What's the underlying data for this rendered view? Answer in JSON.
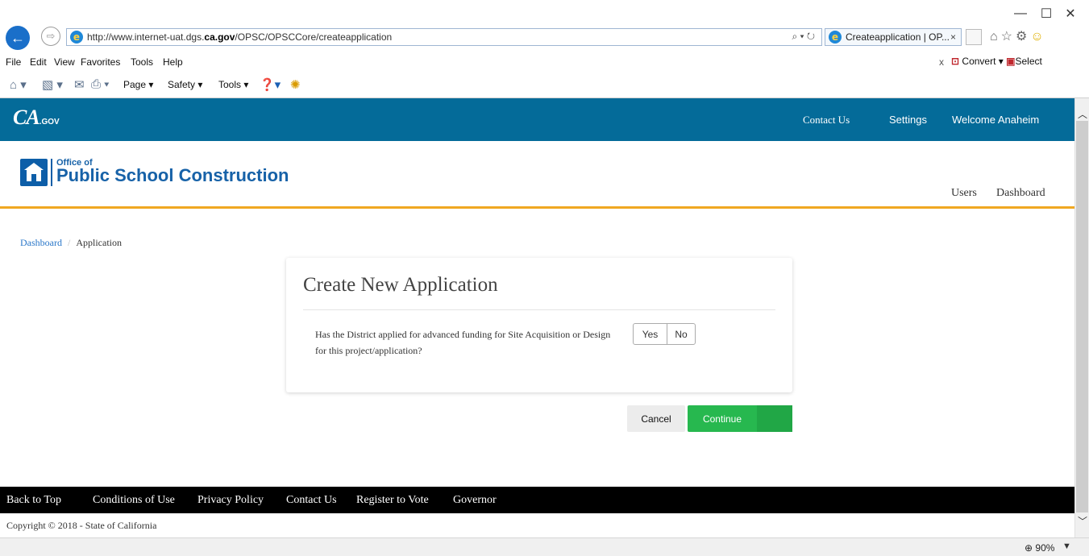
{
  "browser": {
    "url_prefix": "http://www.internet-uat.dgs.",
    "url_domain": "ca.gov",
    "url_path": "/OPSC/OPSCCore/createapplication",
    "address_tools": "⌕ ▾ ↻",
    "tab_title": "Createapplication | OP...",
    "tab_close": "×",
    "window_minimize": "—",
    "window_maximize": "☐",
    "window_close": "✕",
    "back": "←",
    "forward": "⇨",
    "toolbar_close": "x",
    "convert_label": "Convert",
    "select_label": "Select",
    "menu": [
      "File",
      "Edit",
      "View",
      "Favorites",
      "Tools",
      "Help"
    ],
    "commands": {
      "page": "Page ▾",
      "safety": "Safety ▾",
      "tools": "Tools ▾"
    },
    "zoom": "90%"
  },
  "site": {
    "logo_main": "CA",
    "logo_small": ".GOV",
    "topnav": {
      "contact": "Contact Us",
      "settings": "Settings",
      "welcome": "Welcome Anaheim"
    },
    "org_prefix": "Office of",
    "org_name": "Public School Construction",
    "header_nav": {
      "users": "Users",
      "dashboard": "Dashboard"
    }
  },
  "breadcrumb": {
    "dashboard": "Dashboard",
    "separator": "/",
    "current": "Application"
  },
  "form": {
    "title": "Create New Application",
    "question": "Has the District applied for advanced funding for Site Acquisition or Design for this project/application?",
    "yes_label": "Yes",
    "no_label": "No",
    "cancel_label": "Cancel",
    "continue_label": "Continue"
  },
  "footer": {
    "links": [
      "Back to Top",
      "Conditions of Use",
      "Privacy Policy",
      "Contact Us",
      "Register to Vote",
      "Governor"
    ],
    "copyright": "Copyright © 2018 - State of California"
  }
}
